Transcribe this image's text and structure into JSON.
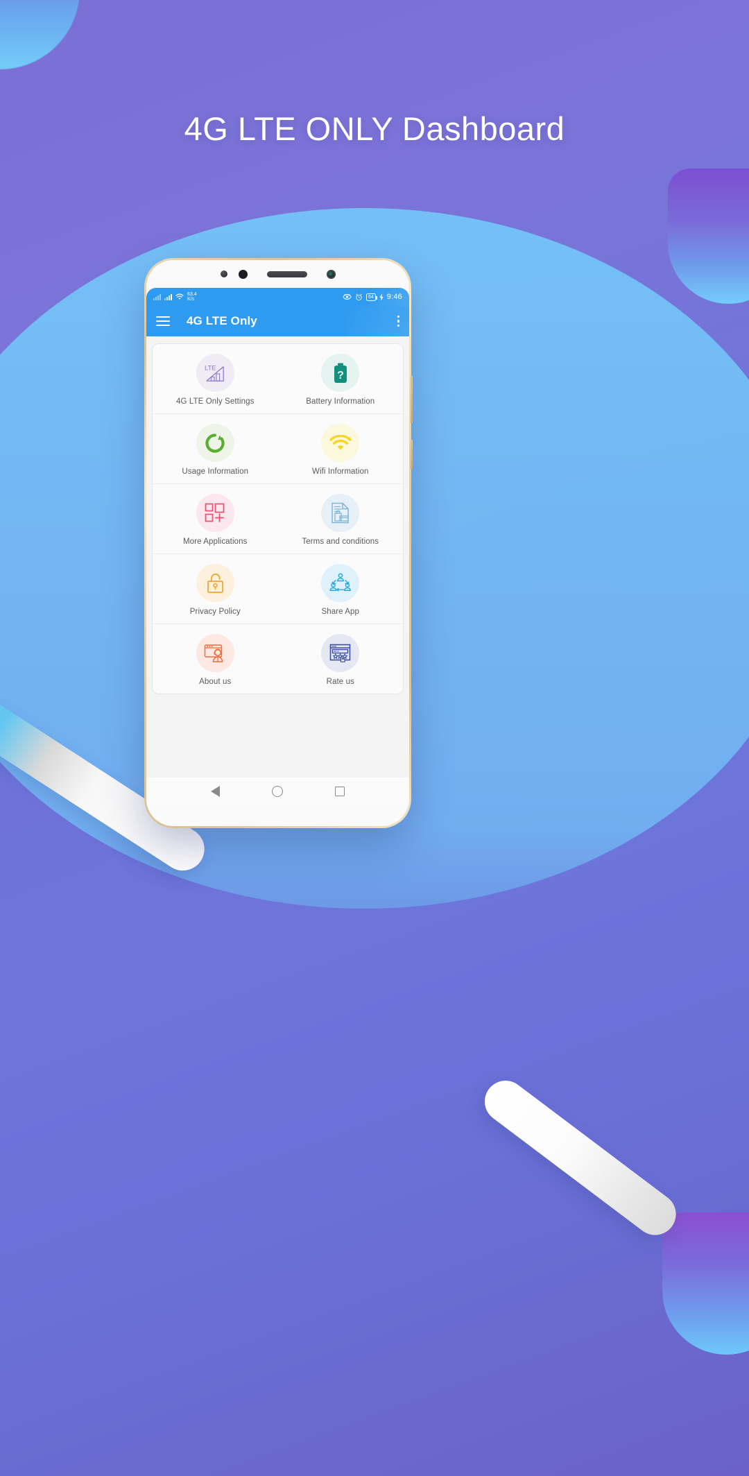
{
  "page": {
    "heading": "4G LTE ONLY Dashboard",
    "background_top_color": "#7a6fd4",
    "background_bottom_color": "#6a62c8",
    "accent_blue": "#74c2f7"
  },
  "phone": {
    "bezel_color": "#e0cba4",
    "status_bar": {
      "network_speed": "63.4",
      "network_speed_unit": "K/s",
      "battery_level": "64",
      "clock": "9:46",
      "icons": [
        "signal-bars-icon",
        "signal-bars-icon",
        "wifi-icon",
        "eye-icon",
        "alarm-clock-icon",
        "battery-icon",
        "charging-bolt-icon"
      ],
      "bar_color": "#2e9bf0"
    },
    "app_bar": {
      "menu_icon": "hamburger-menu-icon",
      "title": "4G LTE Only",
      "overflow_icon": "kebab-menu-icon",
      "bar_color": "#2e9bf0"
    },
    "dashboard": {
      "rows": [
        [
          {
            "label": "4G LTE Only  Settings",
            "icon": "lte-signal-icon",
            "icon_color": "#8b7ad1",
            "bg_color": "#f0ecf6"
          },
          {
            "label": "Battery Information",
            "icon": "battery-question-icon",
            "icon_color": "#12907d",
            "bg_color": "#e6f4f1"
          }
        ],
        [
          {
            "label": "Usage Information",
            "icon": "usage-donut-icon",
            "icon_color": "#5aad33",
            "bg_color": "#eef5e8"
          },
          {
            "label": "Wifi Information",
            "icon": "wifi-signal-icon",
            "icon_color": "#f5d71e",
            "bg_color": "#fbf8dd"
          }
        ],
        [
          {
            "label": "More Applications",
            "icon": "grid-plus-icon",
            "icon_color": "#e9516f",
            "bg_color": "#fbe7ed"
          },
          {
            "label": "Terms and conditions",
            "icon": "document-icon",
            "icon_color": "#7fb4d8",
            "bg_color": "#e8f0f7"
          }
        ],
        [
          {
            "label": "Privacy Policy",
            "icon": "padlock-icon",
            "icon_color": "#f0a53a",
            "bg_color": "#fdf1dd"
          },
          {
            "label": "Share App",
            "icon": "share-network-icon",
            "icon_color": "#2aa8e0",
            "bg_color": "#dff1fb"
          }
        ],
        [
          {
            "label": "About us",
            "icon": "support-agent-icon",
            "icon_color": "#f06a3c",
            "bg_color": "#fde9e2"
          },
          {
            "label": "Rate us",
            "icon": "rating-stars-icon",
            "icon_color": "#3b4fa8",
            "bg_color": "#e5e7f3"
          }
        ]
      ]
    },
    "nav_bar": {
      "back_icon": "back-triangle-icon",
      "home_icon": "home-circle-icon",
      "recents_icon": "recents-square-icon"
    }
  }
}
